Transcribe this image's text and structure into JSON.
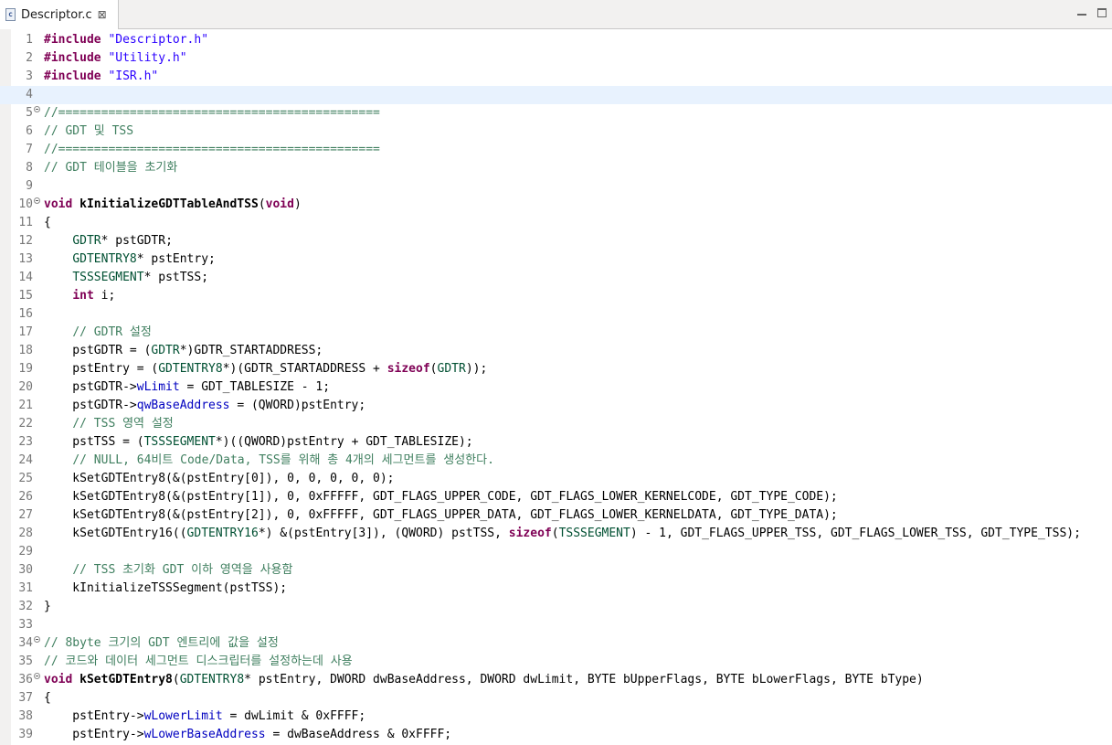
{
  "tab": {
    "title": "Descriptor.c",
    "close_glyph": "⊠",
    "icon": "c-file-icon"
  },
  "window": {
    "minimize": "minimize-icon",
    "maximize": "maximize-icon"
  },
  "colors": {
    "keyword": "#7f0055",
    "string": "#2a00ff",
    "comment": "#3f7f5f",
    "type": "#005032",
    "field": "#0000c0",
    "current_line": "#e8f2fe"
  },
  "current_line": 4,
  "lines": [
    {
      "n": "1",
      "fold": false,
      "tokens": [
        [
          "kw",
          "#include"
        ],
        [
          "tx",
          " "
        ],
        [
          "str",
          "\"Descriptor.h\""
        ]
      ]
    },
    {
      "n": "2",
      "fold": false,
      "tokens": [
        [
          "kw",
          "#include"
        ],
        [
          "tx",
          " "
        ],
        [
          "str",
          "\"Utility.h\""
        ]
      ]
    },
    {
      "n": "3",
      "fold": false,
      "tokens": [
        [
          "kw",
          "#include"
        ],
        [
          "tx",
          " "
        ],
        [
          "str",
          "\"ISR.h\""
        ]
      ]
    },
    {
      "n": "4",
      "fold": false,
      "tokens": []
    },
    {
      "n": "5",
      "fold": true,
      "tokens": [
        [
          "cm",
          "//============================================="
        ]
      ]
    },
    {
      "n": "6",
      "fold": false,
      "tokens": [
        [
          "cm",
          "// GDT 및 TSS"
        ]
      ]
    },
    {
      "n": "7",
      "fold": false,
      "tokens": [
        [
          "cm",
          "//============================================="
        ]
      ]
    },
    {
      "n": "8",
      "fold": false,
      "tokens": [
        [
          "cm",
          "// GDT 테이블을 초기화"
        ]
      ]
    },
    {
      "n": "9",
      "fold": false,
      "tokens": []
    },
    {
      "n": "10",
      "fold": true,
      "tokens": [
        [
          "kw",
          "void"
        ],
        [
          "tx",
          " "
        ],
        [
          "fn",
          "kInitializeGDTTableAndTSS"
        ],
        [
          "tx",
          "("
        ],
        [
          "kw",
          "void"
        ],
        [
          "tx",
          ")"
        ]
      ]
    },
    {
      "n": "11",
      "fold": false,
      "tokens": [
        [
          "tx",
          "{"
        ]
      ]
    },
    {
      "n": "12",
      "fold": false,
      "tokens": [
        [
          "tx",
          "    "
        ],
        [
          "ty",
          "GDTR"
        ],
        [
          "tx",
          "* pstGDTR;"
        ]
      ]
    },
    {
      "n": "13",
      "fold": false,
      "tokens": [
        [
          "tx",
          "    "
        ],
        [
          "ty",
          "GDTENTRY8"
        ],
        [
          "tx",
          "* pstEntry;"
        ]
      ]
    },
    {
      "n": "14",
      "fold": false,
      "tokens": [
        [
          "tx",
          "    "
        ],
        [
          "ty",
          "TSSSEGMENT"
        ],
        [
          "tx",
          "* pstTSS;"
        ]
      ]
    },
    {
      "n": "15",
      "fold": false,
      "tokens": [
        [
          "tx",
          "    "
        ],
        [
          "kw",
          "int"
        ],
        [
          "tx",
          " i;"
        ]
      ]
    },
    {
      "n": "16",
      "fold": false,
      "tokens": []
    },
    {
      "n": "17",
      "fold": false,
      "tokens": [
        [
          "tx",
          "    "
        ],
        [
          "cm",
          "// GDTR 설정"
        ]
      ]
    },
    {
      "n": "18",
      "fold": false,
      "tokens": [
        [
          "tx",
          "    pstGDTR = ("
        ],
        [
          "ty",
          "GDTR"
        ],
        [
          "tx",
          "*)GDTR_STARTADDRESS;"
        ]
      ]
    },
    {
      "n": "19",
      "fold": false,
      "tokens": [
        [
          "tx",
          "    pstEntry = ("
        ],
        [
          "ty",
          "GDTENTRY8"
        ],
        [
          "tx",
          "*)(GDTR_STARTADDRESS + "
        ],
        [
          "kw",
          "sizeof"
        ],
        [
          "tx",
          "("
        ],
        [
          "ty",
          "GDTR"
        ],
        [
          "tx",
          "));"
        ]
      ]
    },
    {
      "n": "20",
      "fold": false,
      "tokens": [
        [
          "tx",
          "    pstGDTR->"
        ],
        [
          "fld",
          "wLimit"
        ],
        [
          "tx",
          " = GDT_TABLESIZE - 1;"
        ]
      ]
    },
    {
      "n": "21",
      "fold": false,
      "tokens": [
        [
          "tx",
          "    pstGDTR->"
        ],
        [
          "fld",
          "qwBaseAddress"
        ],
        [
          "tx",
          " = (QWORD)pstEntry;"
        ]
      ]
    },
    {
      "n": "22",
      "fold": false,
      "tokens": [
        [
          "tx",
          "    "
        ],
        [
          "cm",
          "// TSS 영역 설정"
        ]
      ]
    },
    {
      "n": "23",
      "fold": false,
      "tokens": [
        [
          "tx",
          "    pstTSS = ("
        ],
        [
          "ty",
          "TSSSEGMENT"
        ],
        [
          "tx",
          "*)((QWORD)pstEntry + GDT_TABLESIZE);"
        ]
      ]
    },
    {
      "n": "24",
      "fold": false,
      "tokens": [
        [
          "tx",
          "    "
        ],
        [
          "cm",
          "// NULL, 64비트 Code/Data, TSS를 위해 총 4개의 세그먼트를 생성한다."
        ]
      ]
    },
    {
      "n": "25",
      "fold": false,
      "tokens": [
        [
          "tx",
          "    kSetGDTEntry8(&(pstEntry[0]), 0, 0, 0, 0, 0);"
        ]
      ]
    },
    {
      "n": "26",
      "fold": false,
      "tokens": [
        [
          "tx",
          "    kSetGDTEntry8(&(pstEntry[1]), 0, 0xFFFFF, GDT_FLAGS_UPPER_CODE, GDT_FLAGS_LOWER_KERNELCODE, GDT_TYPE_CODE);"
        ]
      ]
    },
    {
      "n": "27",
      "fold": false,
      "tokens": [
        [
          "tx",
          "    kSetGDTEntry8(&(pstEntry[2]), 0, 0xFFFFF, GDT_FLAGS_UPPER_DATA, GDT_FLAGS_LOWER_KERNELDATA, GDT_TYPE_DATA);"
        ]
      ]
    },
    {
      "n": "28",
      "fold": false,
      "tokens": [
        [
          "tx",
          "    kSetGDTEntry16(("
        ],
        [
          "ty",
          "GDTENTRY16"
        ],
        [
          "tx",
          "*) &(pstEntry[3]), (QWORD) pstTSS, "
        ],
        [
          "kw",
          "sizeof"
        ],
        [
          "tx",
          "("
        ],
        [
          "ty",
          "TSSSEGMENT"
        ],
        [
          "tx",
          ") - 1, GDT_FLAGS_UPPER_TSS, GDT_FLAGS_LOWER_TSS, GDT_TYPE_TSS);"
        ]
      ]
    },
    {
      "n": "29",
      "fold": false,
      "tokens": []
    },
    {
      "n": "30",
      "fold": false,
      "tokens": [
        [
          "tx",
          "    "
        ],
        [
          "cm",
          "// TSS 초기화 GDT 이하 영역을 사용함"
        ]
      ]
    },
    {
      "n": "31",
      "fold": false,
      "tokens": [
        [
          "tx",
          "    kInitializeTSSSegment(pstTSS);"
        ]
      ]
    },
    {
      "n": "32",
      "fold": false,
      "tokens": [
        [
          "tx",
          "}"
        ]
      ]
    },
    {
      "n": "33",
      "fold": false,
      "tokens": []
    },
    {
      "n": "34",
      "fold": true,
      "tokens": [
        [
          "cm",
          "// 8byte 크기의 GDT 엔트리에 값을 설정"
        ]
      ]
    },
    {
      "n": "35",
      "fold": false,
      "tokens": [
        [
          "cm",
          "// 코드와 데이터 세그먼트 디스크립터를 설정하는데 사용"
        ]
      ]
    },
    {
      "n": "36",
      "fold": true,
      "tokens": [
        [
          "kw",
          "void"
        ],
        [
          "tx",
          " "
        ],
        [
          "fn",
          "kSetGDTEntry8"
        ],
        [
          "tx",
          "("
        ],
        [
          "ty",
          "GDTENTRY8"
        ],
        [
          "tx",
          "* pstEntry, DWORD dwBaseAddress, DWORD dwLimit, BYTE bUpperFlags, BYTE bLowerFlags, BYTE bType)"
        ]
      ]
    },
    {
      "n": "37",
      "fold": false,
      "tokens": [
        [
          "tx",
          "{"
        ]
      ]
    },
    {
      "n": "38",
      "fold": false,
      "tokens": [
        [
          "tx",
          "    pstEntry->"
        ],
        [
          "fld",
          "wLowerLimit"
        ],
        [
          "tx",
          " = dwLimit & 0xFFFF;"
        ]
      ]
    },
    {
      "n": "39",
      "fold": false,
      "tokens": [
        [
          "tx",
          "    pstEntry->"
        ],
        [
          "fld",
          "wLowerBaseAddress"
        ],
        [
          "tx",
          " = dwBaseAddress & 0xFFFF;"
        ]
      ]
    }
  ]
}
